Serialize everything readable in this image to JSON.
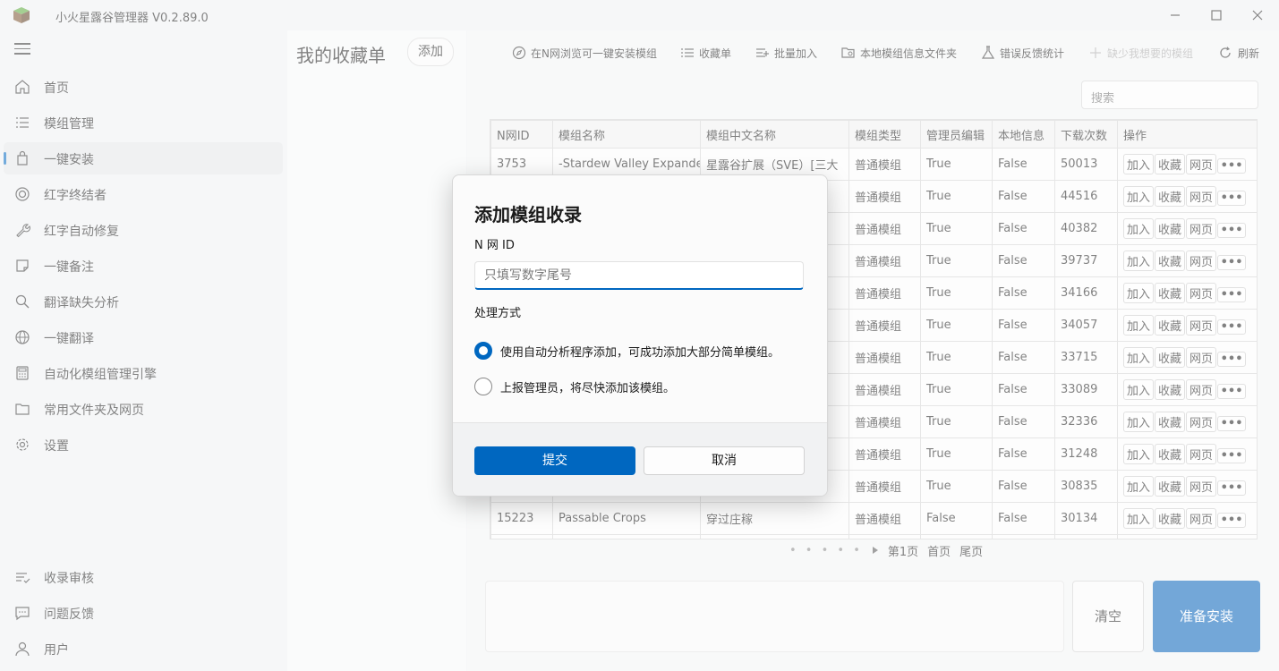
{
  "app": {
    "title": "小火星露谷管理器 V0.2.89.0",
    "accent": "#0067c0"
  },
  "sidebar": {
    "items": [
      {
        "label": "首页",
        "icon": "home-icon"
      },
      {
        "label": "模组管理",
        "icon": "list-icon"
      },
      {
        "label": "一键安装",
        "icon": "bag-icon",
        "active": true
      },
      {
        "label": "红字终结者",
        "icon": "target-icon"
      },
      {
        "label": "红字自动修复",
        "icon": "wrench-icon"
      },
      {
        "label": "一键备注",
        "icon": "note-icon"
      },
      {
        "label": "翻译缺失分析",
        "icon": "search-icon"
      },
      {
        "label": "一键翻译",
        "icon": "globe-icon"
      },
      {
        "label": "自动化模组管理引擎",
        "icon": "calculator-icon"
      },
      {
        "label": "常用文件夹及网页",
        "icon": "folder-icon"
      },
      {
        "label": "设置",
        "icon": "gear-icon"
      }
    ],
    "bottom_items": [
      {
        "label": "收录审核",
        "icon": "review-icon"
      },
      {
        "label": "问题反馈",
        "icon": "chat-icon"
      },
      {
        "label": "用户",
        "icon": "user-icon"
      }
    ]
  },
  "favorites": {
    "title": "我的收藏单",
    "add_label": "添加"
  },
  "toolbar": {
    "browse": "在N网浏览可一键安装模组",
    "favlist": "收藏单",
    "batch": "批量加入",
    "local_folder": "本地模组信息文件夹",
    "error_stats": "错误反馈统计",
    "missing_mod": "缺少我想要的模组",
    "refresh": "刷新"
  },
  "search": {
    "placeholder": "搜索"
  },
  "table": {
    "headers": [
      "N网ID",
      "模组名称",
      "模组中文名称",
      "模组类型",
      "管理员编辑",
      "本地信息",
      "下载次数",
      "操作"
    ],
    "actions": {
      "add": "加入",
      "fav": "收藏",
      "web": "网页",
      "more": "•••"
    },
    "rows": [
      {
        "id": "3753",
        "name": "-Stardew Valley Expanded",
        "cn": "星露谷扩展（SVE）[三大",
        "type": "普通模组",
        "admin": "True",
        "local": "False",
        "downloads": "50013"
      },
      {
        "id": "",
        "name": "",
        "cn": "",
        "type": "普通模组",
        "admin": "True",
        "local": "False",
        "downloads": "44516"
      },
      {
        "id": "",
        "name": "",
        "cn": "",
        "type": "普通模组",
        "admin": "True",
        "local": "False",
        "downloads": "40382"
      },
      {
        "id": "",
        "name": "",
        "cn": "",
        "type": "普通模组",
        "admin": "True",
        "local": "False",
        "downloads": "39737"
      },
      {
        "id": "",
        "name": "",
        "cn": "",
        "type": "普通模组",
        "admin": "True",
        "local": "False",
        "downloads": "34166"
      },
      {
        "id": "",
        "name": "",
        "cn": "",
        "type": "普通模组",
        "admin": "True",
        "local": "False",
        "downloads": "34057"
      },
      {
        "id": "",
        "name": "",
        "cn": "",
        "type": "普通模组",
        "admin": "True",
        "local": "False",
        "downloads": "33715"
      },
      {
        "id": "",
        "name": "",
        "cn": "",
        "type": "普通模组",
        "admin": "True",
        "local": "False",
        "downloads": "33089"
      },
      {
        "id": "",
        "name": "",
        "cn": "",
        "type": "普通模组",
        "admin": "True",
        "local": "False",
        "downloads": "32336"
      },
      {
        "id": "",
        "name": "",
        "cn": "",
        "type": "普通模组",
        "admin": "True",
        "local": "False",
        "downloads": "31248"
      },
      {
        "id": "",
        "name": "",
        "cn": "",
        "type": "普通模组",
        "admin": "True",
        "local": "False",
        "downloads": "30835"
      },
      {
        "id": "15223",
        "name": "Passable Crops",
        "cn": "穿过庄稼",
        "type": "普通模组",
        "admin": "False",
        "local": "False",
        "downloads": "30134"
      },
      {
        "id": "",
        "name": "",
        "cn": "",
        "type": "",
        "admin": "",
        "local": "",
        "downloads": ""
      }
    ]
  },
  "pager": {
    "dots": "• • • • •",
    "current": "第1页",
    "first": "首页",
    "last": "尾页"
  },
  "bottom": {
    "clear": "清空",
    "install": "准备安装"
  },
  "dialog": {
    "title": "添加模组收录",
    "id_label": "N 网 ID",
    "id_placeholder": "只填写数字尾号",
    "method_label": "处理方式",
    "option_auto": "使用自动分析程序添加，可成功添加大部分简单模组。",
    "option_report": "上报管理员，将尽快添加该模组。",
    "submit": "提交",
    "cancel": "取消"
  }
}
